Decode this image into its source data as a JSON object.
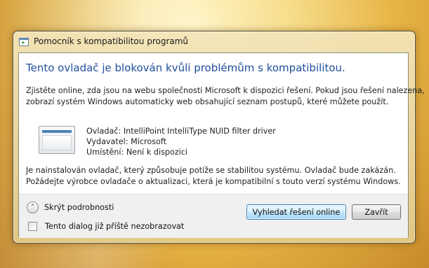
{
  "window": {
    "title": "Pomocník s kompatibilitou programů"
  },
  "dialog": {
    "heading": "Tento ovladač je blokován kvůli problémům s kompatibilitou.",
    "description_line1": "Zjistěte online, zda jsou na webu společnosti Microsoft k dispozici řešení. Pokud jsou řešení nalezena,",
    "description_line2": "zobrazí systém Windows automaticky web obsahující seznam postupů, které můžete použít.",
    "driver": {
      "name_line": "Ovladač: IntelliPoint IntelliType NUID filter driver",
      "publisher_line": "Vydavatel: Microsoft",
      "location_line": "Umístění: Není k dispozici"
    },
    "warning_line1": "Je nainstalován ovladač, který způsobuje potíže se stabilitou systému. Ovladač bude zakázán.",
    "warning_line2": "Požádejte výrobce ovladače o aktualizaci, která je kompatibilní s touto verzí systému Windows."
  },
  "footer": {
    "toggle_details_label": "Skrýt podrobnosti",
    "toggle_icon": "chevron-up-icon",
    "dont_show_label": "Tento dialog již příště nezobrazovat",
    "dont_show_checked": false,
    "search_online_label": "Vyhledat řešení online",
    "close_label": "Zavřít"
  },
  "colors": {
    "heading": "#1f4e9c",
    "primary_button_border": "#3c7fb1"
  }
}
